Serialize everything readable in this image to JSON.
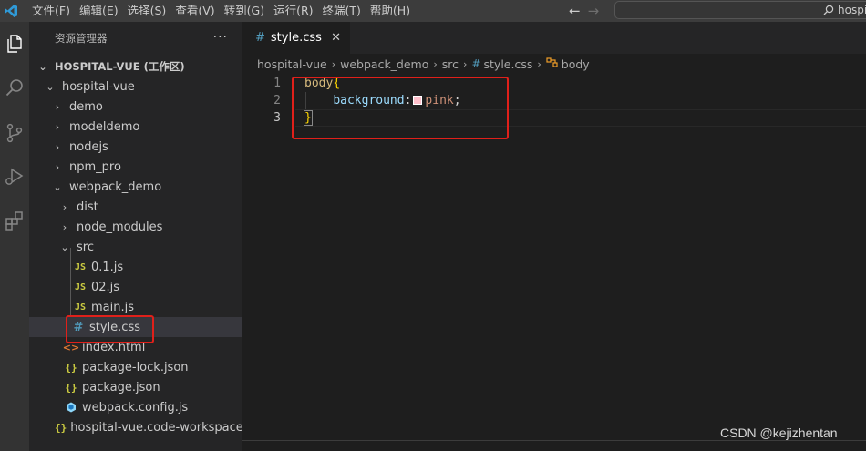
{
  "menu": [
    "文件(F)",
    "编辑(E)",
    "选择(S)",
    "查看(V)",
    "转到(G)",
    "运行(R)",
    "终端(T)",
    "帮助(H)"
  ],
  "search": {
    "text": "hospi"
  },
  "sidebar": {
    "title": "资源管理器",
    "root": "HOSPITAL-VUE (工作区)",
    "items": [
      {
        "label": "hospital-vue"
      },
      {
        "label": "demo"
      },
      {
        "label": "modeldemo"
      },
      {
        "label": "nodejs"
      },
      {
        "label": "npm_pro"
      },
      {
        "label": "webpack_demo"
      },
      {
        "label": "dist"
      },
      {
        "label": "node_modules"
      },
      {
        "label": "src"
      },
      {
        "label": "0.1.js",
        "icon": "JS"
      },
      {
        "label": "02.js",
        "icon": "JS"
      },
      {
        "label": "main.js",
        "icon": "JS"
      },
      {
        "label": "style.css",
        "icon": "#"
      },
      {
        "label": "index.html",
        "icon": "<>"
      },
      {
        "label": "package-lock.json",
        "icon": "{}"
      },
      {
        "label": "package.json",
        "icon": "{}"
      },
      {
        "label": "webpack.config.js"
      },
      {
        "label": "hospital-vue.code-workspace",
        "icon": "{}"
      }
    ]
  },
  "editor": {
    "tab": {
      "icon": "#",
      "label": "style.css",
      "close": "✕"
    },
    "breadcrumb": [
      "hospital-vue",
      "webpack_demo",
      "src",
      "style.css",
      "body"
    ],
    "lines": [
      {
        "num": "1",
        "selector": "body",
        "brace": "{"
      },
      {
        "num": "2",
        "property": "background",
        "colon": ":",
        "value": "pink",
        "semicolon": ";"
      },
      {
        "num": "3",
        "brace": "}"
      }
    ]
  },
  "watermark": "CSDN @kejizhentan",
  "colors": {
    "titlebar": "#3c3c3c",
    "activitybar": "#333333",
    "sidebar": "#252526",
    "editor": "#1e1e1e",
    "highlight_box": "#e0201a",
    "swatch_pink": "#ffc0cb"
  }
}
